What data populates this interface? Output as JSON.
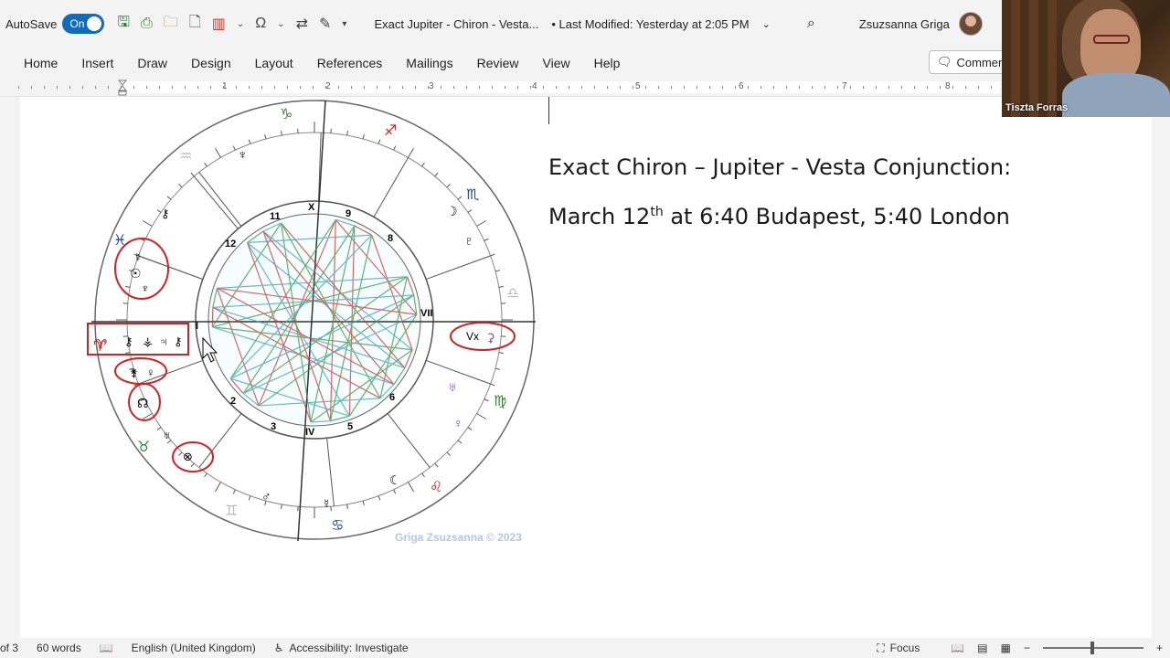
{
  "titlebar": {
    "autosave_label": "AutoSave",
    "autosave_state": "On",
    "doc_title": "Exact Jupiter - Chiron - Vesta...",
    "modified": "• Last Modified: Yesterday at 2:05 PM",
    "user_name": "Zsuzsanna Griga"
  },
  "ribbon": {
    "tabs": [
      "Home",
      "Insert",
      "Draw",
      "Design",
      "Layout",
      "References",
      "Mailings",
      "Review",
      "View",
      "Help"
    ],
    "comments_label": "Commen"
  },
  "ruler": {
    "numbers": [
      "1",
      "2",
      "3",
      "4",
      "5",
      "6",
      "7",
      "8"
    ]
  },
  "document": {
    "heading_line1": "Exact Chiron – Jupiter - Vesta Conjunction:",
    "heading_line2_a": "March 12",
    "heading_line2_sup": "th",
    "heading_line2_b": " at 6:40 Budapest, 5:40 London"
  },
  "chart": {
    "watermark": "Griga Zsuzsanna © 2023",
    "house_numbers": [
      "X",
      "9",
      "8",
      "VII",
      "6",
      "5",
      "IV",
      "3",
      "2",
      "I",
      "12",
      "11"
    ],
    "annotation_labels": {
      "vertex": "Vx"
    }
  },
  "video": {
    "participant": "Tiszta Forras"
  },
  "status": {
    "page": "of 3",
    "words": "60 words",
    "language": "English (United Kingdom)",
    "accessibility": "Accessibility: Investigate",
    "focus": "Focus"
  },
  "colors": {
    "accent": "#0f6cbd",
    "annotation": "#d42020"
  }
}
